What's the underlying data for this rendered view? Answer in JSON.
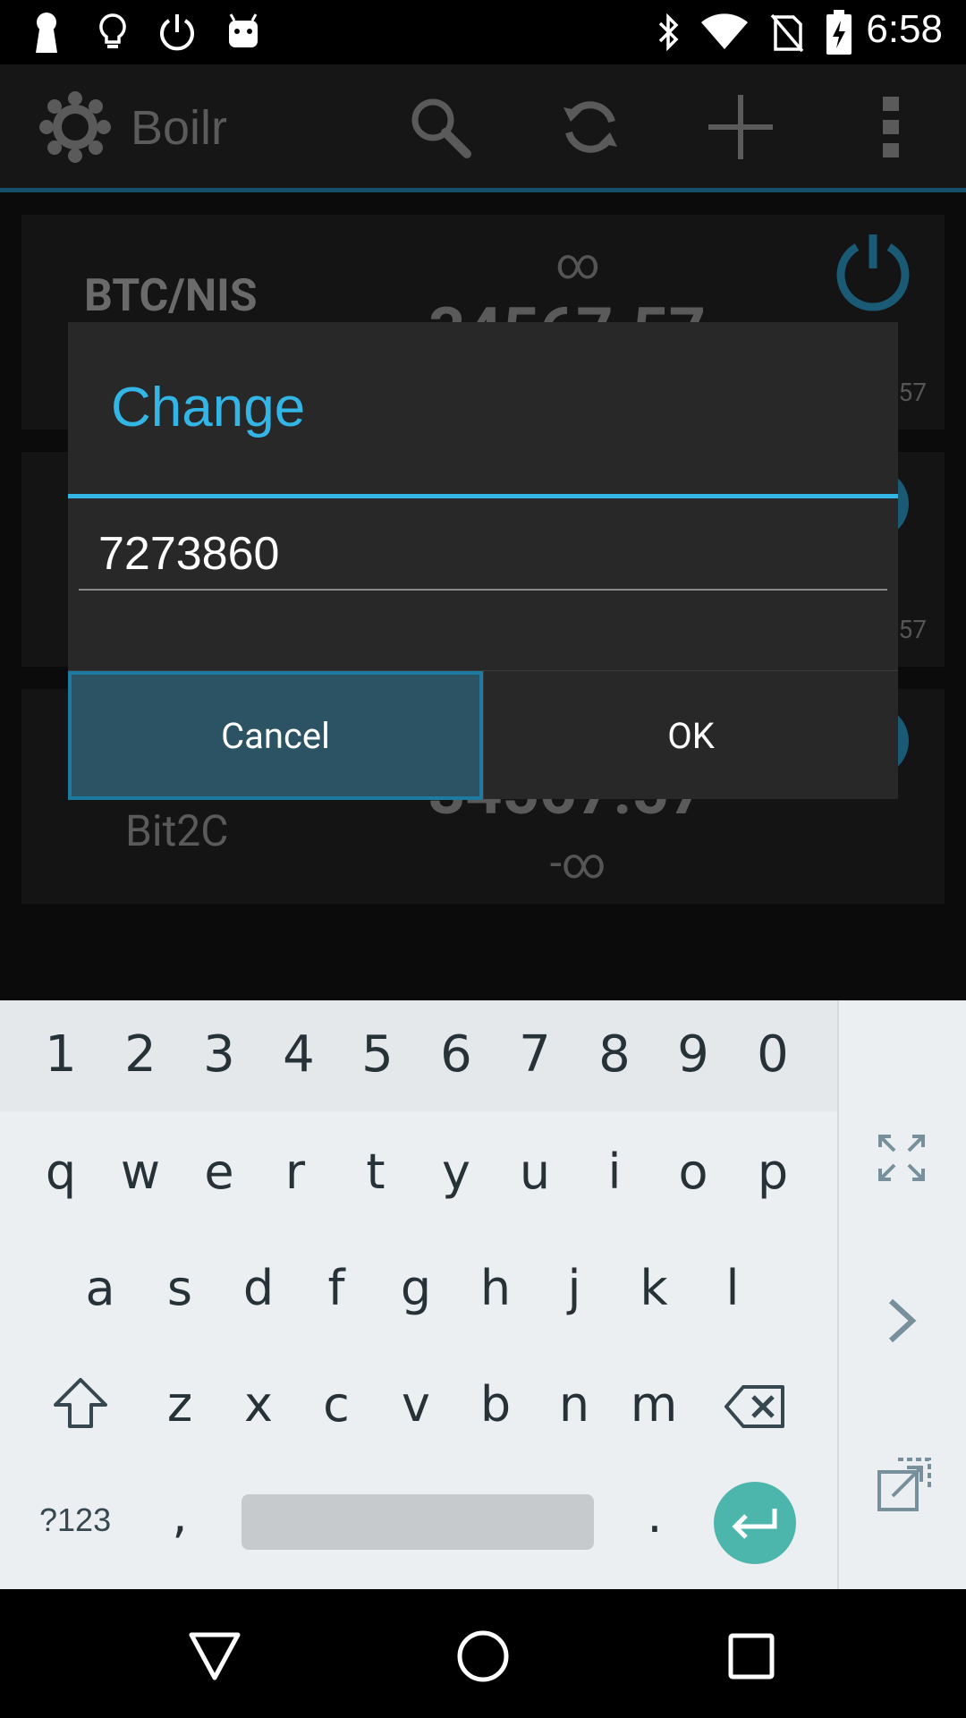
{
  "status_bar": {
    "time": "6:58",
    "icons": [
      "keyhole-icon",
      "lightbulb-icon",
      "power-icon",
      "android-icon",
      "bluetooth-icon",
      "wifi-icon",
      "no-sim-icon",
      "battery-charging-icon"
    ]
  },
  "app_bar": {
    "title": "Boilr",
    "actions": [
      "search-icon",
      "refresh-icon",
      "add-icon",
      "overflow-menu-icon"
    ]
  },
  "cards": [
    {
      "pair": "BTC/NIS",
      "top": "∞",
      "price": "34567.57",
      "small": "57"
    },
    {
      "small": "57"
    },
    {
      "exchange": "Bit2C",
      "price": "34567.57",
      "bottom": "-∞"
    }
  ],
  "dialog": {
    "title": "Change",
    "input_value": "7273860",
    "cancel_label": "Cancel",
    "ok_label": "OK"
  },
  "keyboard": {
    "number_row": [
      "1",
      "2",
      "3",
      "4",
      "5",
      "6",
      "7",
      "8",
      "9",
      "0"
    ],
    "row1": [
      "q",
      "w",
      "e",
      "r",
      "t",
      "y",
      "u",
      "i",
      "o",
      "p"
    ],
    "row2": [
      "a",
      "s",
      "d",
      "f",
      "g",
      "h",
      "j",
      "k",
      "l"
    ],
    "row3": [
      "z",
      "x",
      "c",
      "v",
      "b",
      "n",
      "m"
    ],
    "symbols_label": "?123",
    "comma": ",",
    "period": "."
  },
  "colors": {
    "accent": "#33b5e5",
    "cancel_bg": "#2c5364",
    "enter_key": "#4db6ac"
  }
}
